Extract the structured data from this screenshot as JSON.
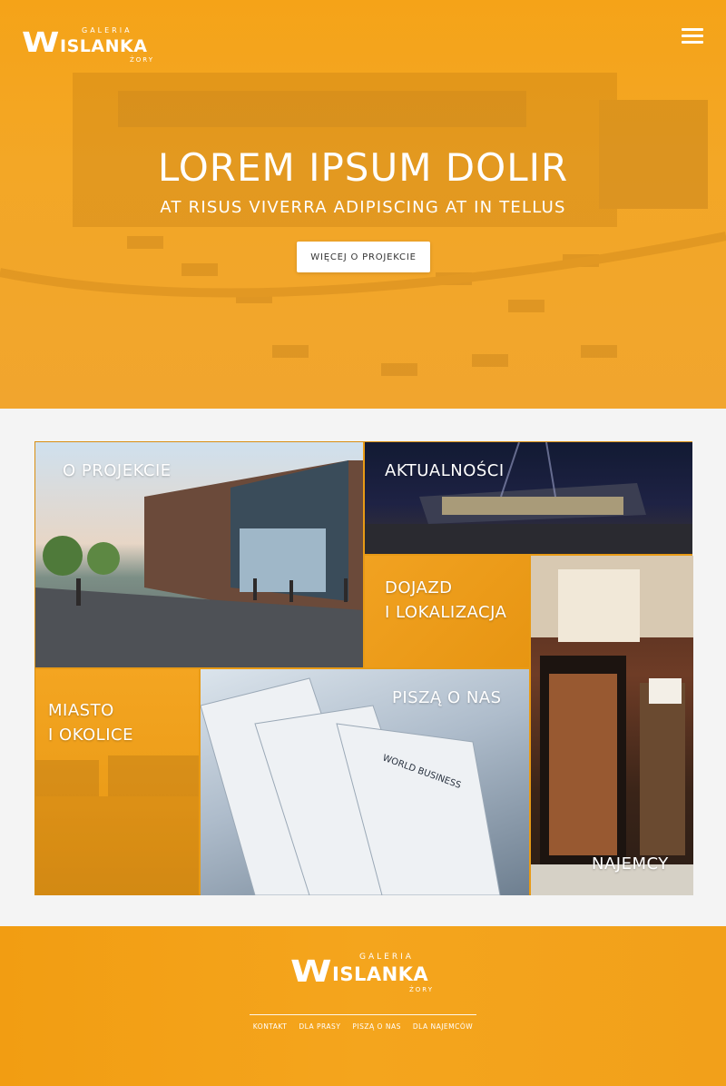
{
  "header": {
    "logo": {
      "mark": "W",
      "name": "ISLANKA",
      "sub": "GALERIA",
      "city": "ŻORY"
    },
    "menu_icon": "hamburger-menu-icon"
  },
  "hero": {
    "title": "LOREM IPSUM DOLIR",
    "subtitle": "AT RISUS VIVERRA ADIPISCING AT IN TELLUS",
    "button_label": "WIĘCEJ O PROJEKCIE",
    "overlay_color": "#f5a318"
  },
  "tiles": [
    {
      "label": "O PROJEKCIE"
    },
    {
      "label": "AKTUALNOŚCI"
    },
    {
      "label": "DOJAZD\nI LOKALIZACJA"
    },
    {
      "label": "NAJEMCY"
    },
    {
      "label": "MIASTO\nI OKOLICE"
    },
    {
      "label": "PISZĄ O NAS"
    }
  ],
  "footer": {
    "logo": {
      "mark": "W",
      "name": "ISLANKA",
      "sub": "GALERIA",
      "city": "ŻORY"
    },
    "links": [
      "KONTAKT",
      "DLA PRASY",
      "PISZĄ O NAS",
      "DLA NAJEMCÓW"
    ]
  },
  "colors": {
    "accent": "#f5a318",
    "background": "#f4f4f4",
    "text_light": "#ffffff"
  }
}
